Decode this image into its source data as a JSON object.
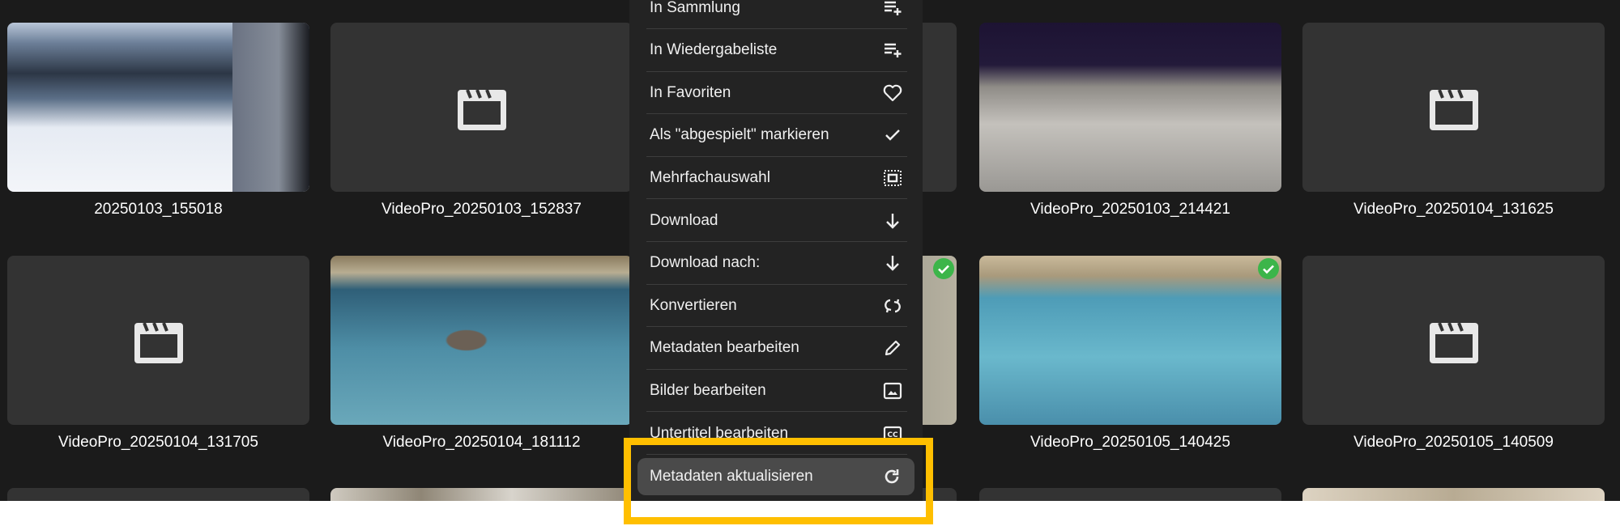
{
  "grid": {
    "rows": [
      [
        {
          "name": "20250103_155018",
          "kind": "photo",
          "style": "p-ski",
          "checked": false
        },
        {
          "name": "VideoPro_20250103_152837",
          "kind": "placeholder",
          "checked": false
        },
        {
          "name": "",
          "kind": "placeholder",
          "checked": false
        },
        {
          "name": "VideoPro_20250103_214421",
          "kind": "photo",
          "style": "p-night",
          "checked": false
        },
        {
          "name": "VideoPro_20250104_131625",
          "kind": "placeholder",
          "checked": false
        }
      ],
      [
        {
          "name": "VideoPro_20250104_131705",
          "kind": "placeholder",
          "checked": false
        },
        {
          "name": "VideoPro_20250104_181112",
          "kind": "photo",
          "style": "p-swim",
          "checked": false
        },
        {
          "name": "",
          "kind": "photo",
          "style": "p-rock",
          "checked": true
        },
        {
          "name": "VideoPro_20250105_140425",
          "kind": "photo",
          "style": "p-pool",
          "checked": true
        },
        {
          "name": "VideoPro_20250105_140509",
          "kind": "placeholder",
          "checked": false
        }
      ],
      [
        {
          "name": "",
          "kind": "placeholder",
          "checked": false
        },
        {
          "name": "",
          "kind": "photo",
          "style": "p-hall",
          "checked": false
        },
        {
          "name": "",
          "kind": "placeholder",
          "checked": false
        },
        {
          "name": "",
          "kind": "placeholder",
          "checked": false
        },
        {
          "name": "",
          "kind": "photo",
          "style": "p-beige",
          "checked": false
        }
      ]
    ]
  },
  "menu": {
    "items": [
      {
        "label": "In Sammlung",
        "icon": "playlist-add-icon"
      },
      {
        "label": "In Wiedergabeliste",
        "icon": "playlist-add-icon"
      },
      {
        "label": "In Favoriten",
        "icon": "heart-icon"
      },
      {
        "label": "Als \"abgespielt\" markieren",
        "icon": "check-icon"
      },
      {
        "label": "Mehrfachauswahl",
        "icon": "select-all-icon"
      },
      {
        "label": "Download",
        "icon": "arrow-down-icon"
      },
      {
        "label": "Download nach:",
        "icon": "arrow-down-icon"
      },
      {
        "label": "Konvertieren",
        "icon": "convert-icon"
      },
      {
        "label": "Metadaten bearbeiten",
        "icon": "pencil-icon"
      },
      {
        "label": "Bilder bearbeiten",
        "icon": "image-icon"
      },
      {
        "label": "Untertitel bearbeiten",
        "icon": "closed-captions-icon"
      },
      {
        "label": "Metadaten aktualisieren",
        "icon": "refresh-icon",
        "highlighted": true
      }
    ]
  },
  "colors": {
    "background": "#1b1b1b",
    "menu": "#232323",
    "highlight": "#4a4a4a",
    "focus_frame": "#ffbf00",
    "check": "#3cb54a"
  }
}
